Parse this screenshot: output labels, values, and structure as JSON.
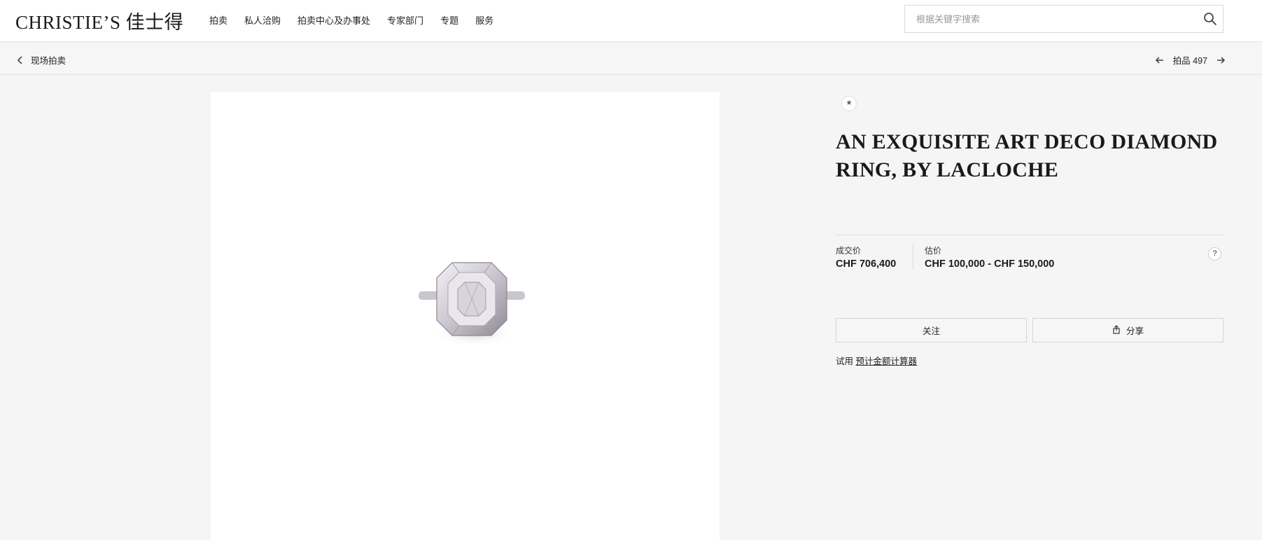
{
  "header": {
    "logo": "CHRISTIE’S 佳士得",
    "nav": [
      "拍卖",
      "私人洽购",
      "拍卖中心及办事处",
      "专家部门",
      "专题",
      "服务"
    ],
    "search": {
      "placeholder": "根据关键字搜索",
      "icon": "search-icon"
    }
  },
  "subnav": {
    "back_label": "现场拍卖",
    "lot_label": "拍品 497"
  },
  "lot": {
    "badge": "*",
    "title": "AN EXQUISITE ART DECO DIAMOND RING, BY LACLOCHE",
    "price_realised_label": "成交价",
    "price_realised": "CHF 706,400",
    "estimate_label": "估价",
    "estimate": "CHF 100,000 - CHF 150,000",
    "help": "?",
    "follow_label": "关注",
    "share_label": "分享",
    "try_prefix": "试用",
    "calculator_link": "预计金额计算器"
  }
}
